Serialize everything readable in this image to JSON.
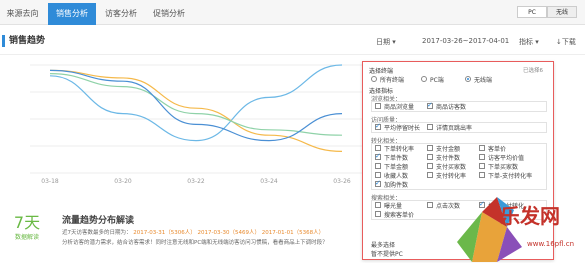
{
  "tabs": [
    {
      "label": "来源去向",
      "active": false
    },
    {
      "label": "销售分析",
      "active": true
    },
    {
      "label": "访客分析",
      "active": false
    },
    {
      "label": "促销分析",
      "active": false
    }
  ],
  "device_toggle": {
    "pc": "PC",
    "wireless": "无线"
  },
  "section": {
    "title": "销售趋势",
    "day_select": "日期",
    "date_range": "2017-03-26~2017-04-01",
    "metric_select": "指标",
    "download": "下载"
  },
  "chart_data": {
    "type": "line",
    "x": [
      "03-18",
      "03-20",
      "03-22",
      "03-24",
      "03-26"
    ],
    "series": [
      {
        "color": "#6cb8e6",
        "values": [
          0.9,
          0.55,
          0.3,
          0.7,
          1.0
        ]
      },
      {
        "color": "#f5b94a",
        "values": [
          0.95,
          0.88,
          0.6,
          0.35,
          0.2
        ]
      },
      {
        "color": "#8fd2a8",
        "values": [
          0.92,
          0.8,
          0.55,
          0.4,
          0.35
        ]
      },
      {
        "color": "#4a8fd4",
        "values": [
          0.95,
          0.85,
          0.45,
          0.3,
          0.55
        ]
      }
    ],
    "grid": true
  },
  "info": {
    "badge_number": "7天",
    "badge_label": "数据解读",
    "title": "流量趋势分布解读",
    "line1_prefix": "近7天访客数最多的日期为：",
    "line1_dates": [
      "2017-03-31（5306人）",
      "2017-03-30（5469人）",
      "2017-01-01（5368人）"
    ],
    "line2": "分析访客的潜力需求，结合访客需求！同时注意无线和PC端和无线端访客访问习惯稿，看看商品上下调时段？",
    "line2_link": "商品上下调时段"
  },
  "popup": {
    "selected_count": "已选择6",
    "terminal_head": "选择终端",
    "terminals": [
      {
        "label": "所有终端",
        "checked": false
      },
      {
        "label": "PC端",
        "checked": false
      },
      {
        "label": "无线端",
        "checked": true
      }
    ],
    "metric_head": "选择指标",
    "groups": [
      {
        "name": "浏览相关：",
        "items": [
          {
            "label": "商品浏览量",
            "checked": false
          },
          {
            "label": "商品访客数",
            "checked": true
          }
        ]
      },
      {
        "name": "访问质量：",
        "items": [
          {
            "label": "平均停留时长",
            "checked": true
          },
          {
            "label": "详情页跳出率",
            "checked": false
          }
        ]
      },
      {
        "name": "转化相关：",
        "items": [
          {
            "label": "下单转化率",
            "checked": false
          },
          {
            "label": "支付金额",
            "checked": false
          },
          {
            "label": "客单价",
            "checked": false
          },
          {
            "label": "下单件数",
            "checked": true
          },
          {
            "label": "支付件数",
            "checked": false
          },
          {
            "label": "访客平均价值",
            "checked": false
          },
          {
            "label": "下单金额",
            "checked": false
          },
          {
            "label": "支付买家数",
            "checked": false
          },
          {
            "label": "下单买家数",
            "checked": false
          },
          {
            "label": "收藏人数",
            "checked": false
          },
          {
            "label": "支付转化率",
            "checked": false
          },
          {
            "label": "下单-支付转化率",
            "checked": false
          },
          {
            "label": "加购件数",
            "checked": true
          }
        ]
      },
      {
        "name": "搜索相关：",
        "items": [
          {
            "label": "曝光量",
            "checked": false
          },
          {
            "label": "点击次数",
            "checked": false
          },
          {
            "label": "搜索支付转化",
            "checked": true
          },
          {
            "label": "搜索客单价",
            "checked": false
          }
        ]
      }
    ],
    "footer": "最多选择",
    "footer2": "暂不提供PC"
  },
  "logo": {
    "text": "乐发网",
    "url": "www.16pfl.cn"
  }
}
